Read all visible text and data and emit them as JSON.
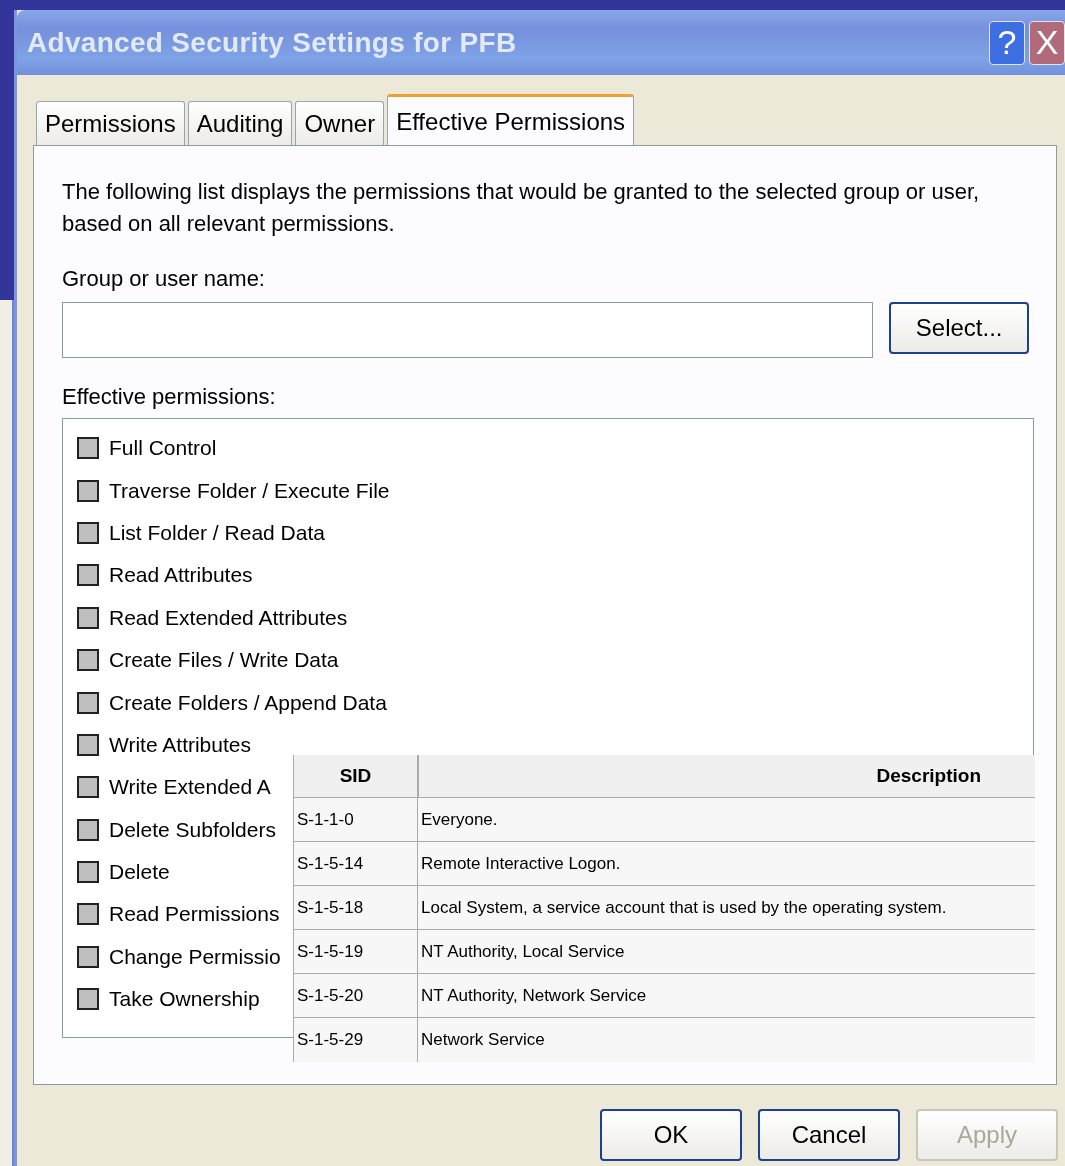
{
  "window": {
    "title": "Advanced Security Settings for PFB",
    "help_button": "?",
    "close_button": "X"
  },
  "tabs": [
    {
      "label": "Permissions",
      "selected": false
    },
    {
      "label": "Auditing",
      "selected": false
    },
    {
      "label": "Owner",
      "selected": false
    },
    {
      "label": "Effective Permissions",
      "selected": true
    }
  ],
  "description": "The following list displays the permissions that would be granted to the selected group or user, based on all relevant permissions.",
  "group_label": "Group or user name:",
  "select_button": "Select...",
  "permissions_label": "Effective permissions:",
  "permissions": [
    {
      "label": "Full Control",
      "checked": false
    },
    {
      "label": "Traverse Folder / Execute File",
      "checked": false
    },
    {
      "label": "List Folder / Read Data",
      "checked": false
    },
    {
      "label": "Read Attributes",
      "checked": false
    },
    {
      "label": "Read Extended Attributes",
      "checked": false
    },
    {
      "label": "Create Files / Write Data",
      "checked": false
    },
    {
      "label": "Create Folders / Append Data",
      "checked": false
    },
    {
      "label": "Write Attributes",
      "checked": false
    },
    {
      "label": "Write Extended A",
      "checked": false
    },
    {
      "label": "Delete Subfolders",
      "checked": false
    },
    {
      "label": "Delete",
      "checked": false
    },
    {
      "label": "Read Permissions",
      "checked": false
    },
    {
      "label": "Change Permissio",
      "checked": false
    },
    {
      "label": "Take Ownership",
      "checked": false
    }
  ],
  "sid_table": {
    "columns": [
      "SID",
      "Description"
    ],
    "rows": [
      [
        "S-1-1-0",
        "Everyone."
      ],
      [
        "S-1-5-14",
        "Remote Interactive Logon."
      ],
      [
        "S-1-5-18",
        "Local System, a service account that is used by the operating system."
      ],
      [
        "S-1-5-19",
        "NT Authority, Local Service"
      ],
      [
        "S-1-5-20",
        "NT Authority, Network Service"
      ],
      [
        "S-1-5-29",
        "Network Service"
      ]
    ]
  },
  "buttons": [
    {
      "label": "OK",
      "disabled": false
    },
    {
      "label": "Cancel",
      "disabled": false
    },
    {
      "label": "Apply",
      "disabled": true
    }
  ]
}
